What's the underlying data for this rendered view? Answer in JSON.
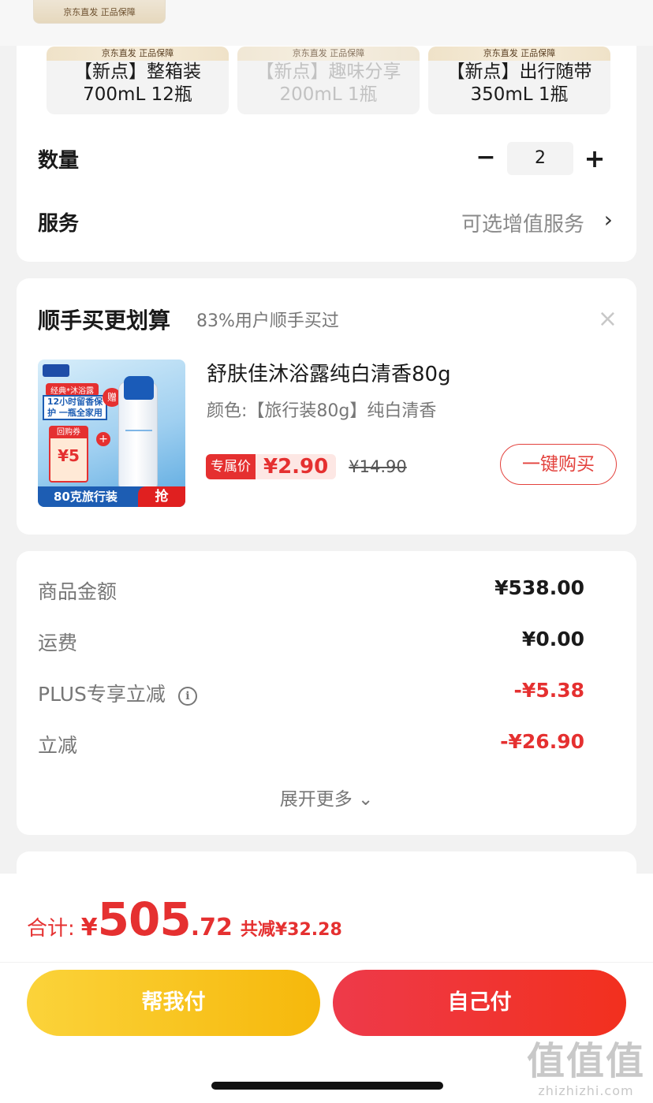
{
  "top_thumb": {
    "badge": "京东直发 正品保障"
  },
  "variants": [
    {
      "badge": "京东直发 正品保障",
      "line1": "【新点】整箱装",
      "line2": "700mL 12瓶",
      "disabled": false
    },
    {
      "badge": "京东直发 正品保障",
      "line1": "【新点】趣味分享",
      "line2": "200mL 1瓶",
      "disabled": true
    },
    {
      "badge": "京东直发 正品保障",
      "line1": "【新点】出行随带",
      "line2": "350mL 1瓶",
      "disabled": false
    }
  ],
  "quantity": {
    "label": "数量",
    "minus": "−",
    "value": "2",
    "plus": "+"
  },
  "service": {
    "label": "服务",
    "value": "可选增值服务",
    "chevron": "›"
  },
  "addon": {
    "title": "顺手买更划算",
    "subtitle": "83%用户顺手买过",
    "close": "×",
    "image_text": {
      "tag": "经典*沐浴露",
      "poster": "12小时留香保护 一瓶全家用",
      "gift": "赠",
      "coupon_top": "回购券",
      "coupon_value": "¥5",
      "plus": "+",
      "strip": "80克旅行装",
      "grab": "抢"
    },
    "name": "舒肤佳沐浴露纯白清香80g",
    "variant": "颜色:【旅行装80g】纯白清香",
    "price_tag": "专属价",
    "price": "¥2.90",
    "original_price": "¥14.90",
    "buy_button": "一键购买"
  },
  "summary": {
    "rows": [
      {
        "label": "商品金额",
        "value": "¥538.00",
        "red": false
      },
      {
        "label": "运费",
        "value": "¥0.00",
        "red": false
      },
      {
        "label": "PLUS专享立减",
        "value": "-¥5.38",
        "red": true
      },
      {
        "label": "立减",
        "value": "-¥26.90",
        "red": true
      }
    ],
    "info_icon": "i",
    "expand": "展开更多 ⌄"
  },
  "footer": {
    "total_label": "合计:",
    "currency": "¥",
    "total_int": "505",
    "total_dec": ".72",
    "saved": "共减¥32.28",
    "help_pay": "帮我付",
    "self_pay": "自己付"
  },
  "watermark": {
    "big": "值值值",
    "small": "zhizhizhi.com"
  },
  "colors": {
    "accent_red": "#e53030",
    "help_yellow": "#f6b80b",
    "self_red": "#f2301e"
  }
}
